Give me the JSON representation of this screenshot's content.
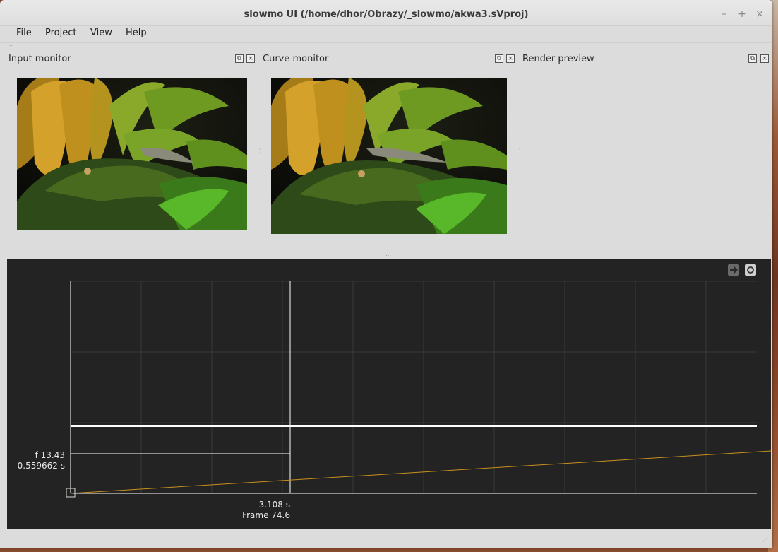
{
  "window": {
    "title": "slowmo UI (/home/dhor/Obrazy/_slowmo/akwa3.sVproj)",
    "controls": {
      "minimize": "–",
      "maximize": "+",
      "close": "×"
    }
  },
  "menu": {
    "items": [
      {
        "label": "File"
      },
      {
        "label": "Project"
      },
      {
        "label": "View"
      },
      {
        "label": "Help"
      }
    ]
  },
  "docks": {
    "input_monitor": {
      "title": "Input monitor"
    },
    "curve_monitor": {
      "title": "Curve monitor"
    },
    "render_preview": {
      "title": "Render preview"
    }
  },
  "curve_editor": {
    "icons": [
      "export-curve-icon",
      "record-icon"
    ],
    "cursor_value": {
      "frame_label": "f 13.43",
      "time_label": "0.559662 s"
    },
    "cursor_position": {
      "time_label": "3.108 s",
      "frame_label": "Frame 74.6"
    },
    "colors": {
      "background": "#232323",
      "grid": "#3a3a3a",
      "axes": "#ffffff",
      "curve": "#c8901e"
    }
  }
}
